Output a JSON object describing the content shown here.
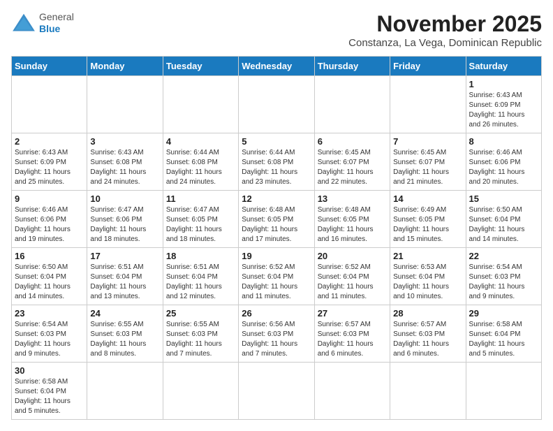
{
  "header": {
    "logo_line1": "General",
    "logo_line2": "Blue",
    "month_title": "November 2025",
    "subtitle": "Constanza, La Vega, Dominican Republic"
  },
  "weekdays": [
    "Sunday",
    "Monday",
    "Tuesday",
    "Wednesday",
    "Thursday",
    "Friday",
    "Saturday"
  ],
  "weeks": [
    [
      {
        "day": "",
        "info": ""
      },
      {
        "day": "",
        "info": ""
      },
      {
        "day": "",
        "info": ""
      },
      {
        "day": "",
        "info": ""
      },
      {
        "day": "",
        "info": ""
      },
      {
        "day": "",
        "info": ""
      },
      {
        "day": "1",
        "info": "Sunrise: 6:43 AM\nSunset: 6:09 PM\nDaylight: 11 hours\nand 26 minutes."
      }
    ],
    [
      {
        "day": "2",
        "info": "Sunrise: 6:43 AM\nSunset: 6:09 PM\nDaylight: 11 hours\nand 25 minutes."
      },
      {
        "day": "3",
        "info": "Sunrise: 6:43 AM\nSunset: 6:08 PM\nDaylight: 11 hours\nand 24 minutes."
      },
      {
        "day": "4",
        "info": "Sunrise: 6:44 AM\nSunset: 6:08 PM\nDaylight: 11 hours\nand 24 minutes."
      },
      {
        "day": "5",
        "info": "Sunrise: 6:44 AM\nSunset: 6:08 PM\nDaylight: 11 hours\nand 23 minutes."
      },
      {
        "day": "6",
        "info": "Sunrise: 6:45 AM\nSunset: 6:07 PM\nDaylight: 11 hours\nand 22 minutes."
      },
      {
        "day": "7",
        "info": "Sunrise: 6:45 AM\nSunset: 6:07 PM\nDaylight: 11 hours\nand 21 minutes."
      },
      {
        "day": "8",
        "info": "Sunrise: 6:46 AM\nSunset: 6:06 PM\nDaylight: 11 hours\nand 20 minutes."
      }
    ],
    [
      {
        "day": "9",
        "info": "Sunrise: 6:46 AM\nSunset: 6:06 PM\nDaylight: 11 hours\nand 19 minutes."
      },
      {
        "day": "10",
        "info": "Sunrise: 6:47 AM\nSunset: 6:06 PM\nDaylight: 11 hours\nand 18 minutes."
      },
      {
        "day": "11",
        "info": "Sunrise: 6:47 AM\nSunset: 6:05 PM\nDaylight: 11 hours\nand 18 minutes."
      },
      {
        "day": "12",
        "info": "Sunrise: 6:48 AM\nSunset: 6:05 PM\nDaylight: 11 hours\nand 17 minutes."
      },
      {
        "day": "13",
        "info": "Sunrise: 6:48 AM\nSunset: 6:05 PM\nDaylight: 11 hours\nand 16 minutes."
      },
      {
        "day": "14",
        "info": "Sunrise: 6:49 AM\nSunset: 6:05 PM\nDaylight: 11 hours\nand 15 minutes."
      },
      {
        "day": "15",
        "info": "Sunrise: 6:50 AM\nSunset: 6:04 PM\nDaylight: 11 hours\nand 14 minutes."
      }
    ],
    [
      {
        "day": "16",
        "info": "Sunrise: 6:50 AM\nSunset: 6:04 PM\nDaylight: 11 hours\nand 14 minutes."
      },
      {
        "day": "17",
        "info": "Sunrise: 6:51 AM\nSunset: 6:04 PM\nDaylight: 11 hours\nand 13 minutes."
      },
      {
        "day": "18",
        "info": "Sunrise: 6:51 AM\nSunset: 6:04 PM\nDaylight: 11 hours\nand 12 minutes."
      },
      {
        "day": "19",
        "info": "Sunrise: 6:52 AM\nSunset: 6:04 PM\nDaylight: 11 hours\nand 11 minutes."
      },
      {
        "day": "20",
        "info": "Sunrise: 6:52 AM\nSunset: 6:04 PM\nDaylight: 11 hours\nand 11 minutes."
      },
      {
        "day": "21",
        "info": "Sunrise: 6:53 AM\nSunset: 6:04 PM\nDaylight: 11 hours\nand 10 minutes."
      },
      {
        "day": "22",
        "info": "Sunrise: 6:54 AM\nSunset: 6:03 PM\nDaylight: 11 hours\nand 9 minutes."
      }
    ],
    [
      {
        "day": "23",
        "info": "Sunrise: 6:54 AM\nSunset: 6:03 PM\nDaylight: 11 hours\nand 9 minutes."
      },
      {
        "day": "24",
        "info": "Sunrise: 6:55 AM\nSunset: 6:03 PM\nDaylight: 11 hours\nand 8 minutes."
      },
      {
        "day": "25",
        "info": "Sunrise: 6:55 AM\nSunset: 6:03 PM\nDaylight: 11 hours\nand 7 minutes."
      },
      {
        "day": "26",
        "info": "Sunrise: 6:56 AM\nSunset: 6:03 PM\nDaylight: 11 hours\nand 7 minutes."
      },
      {
        "day": "27",
        "info": "Sunrise: 6:57 AM\nSunset: 6:03 PM\nDaylight: 11 hours\nand 6 minutes."
      },
      {
        "day": "28",
        "info": "Sunrise: 6:57 AM\nSunset: 6:03 PM\nDaylight: 11 hours\nand 6 minutes."
      },
      {
        "day": "29",
        "info": "Sunrise: 6:58 AM\nSunset: 6:04 PM\nDaylight: 11 hours\nand 5 minutes."
      }
    ],
    [
      {
        "day": "30",
        "info": "Sunrise: 6:58 AM\nSunset: 6:04 PM\nDaylight: 11 hours\nand 5 minutes."
      },
      {
        "day": "",
        "info": ""
      },
      {
        "day": "",
        "info": ""
      },
      {
        "day": "",
        "info": ""
      },
      {
        "day": "",
        "info": ""
      },
      {
        "day": "",
        "info": ""
      },
      {
        "day": "",
        "info": ""
      }
    ]
  ]
}
